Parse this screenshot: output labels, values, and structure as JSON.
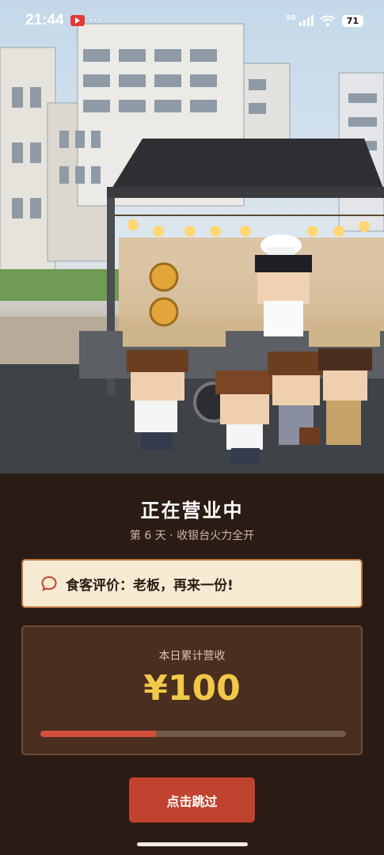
{
  "status_bar": {
    "time": "21:44",
    "dots": "···",
    "network": "5G",
    "battery": "71"
  },
  "scene": {
    "description_icon": "pixel-street-food-stall-scene"
  },
  "main": {
    "title": "正在营业中",
    "subtitle": "第 6 天 · 收银台火力全开",
    "review": {
      "icon": "speech-bubble-icon",
      "text": "食客评价：老板，再来一份!"
    },
    "revenue": {
      "label": "本日累计营收",
      "amount": "¥100",
      "progress": 0.38
    },
    "skip_label": "点击跳过"
  },
  "colors": {
    "accent": "#c0432f",
    "gold": "#f1c84a",
    "background": "#2a1b14",
    "card": "#4a2e1f",
    "review_bg": "#f6ead2"
  }
}
